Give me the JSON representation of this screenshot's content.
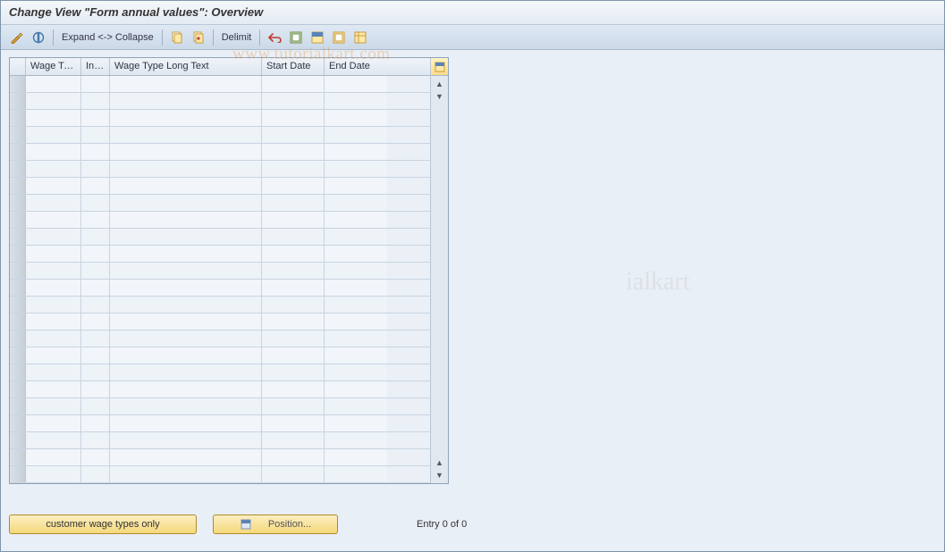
{
  "title": "Change View \"Form annual values\": Overview",
  "toolbar": {
    "expand_collapse_label": "Expand <-> Collapse",
    "delimit_label": "Delimit"
  },
  "grid": {
    "columns": {
      "wage_type": "Wage Ty...",
      "inf": "Inf...",
      "long_text": "Wage Type Long Text",
      "start_date": "Start Date",
      "end_date": "End Date"
    },
    "row_count": 24
  },
  "footer": {
    "customer_btn": "customer wage types only",
    "position_btn": "Position...",
    "entry_text": "Entry 0 of 0"
  },
  "watermark": "www.tutorialkart.com",
  "watermark2": "ialkart"
}
